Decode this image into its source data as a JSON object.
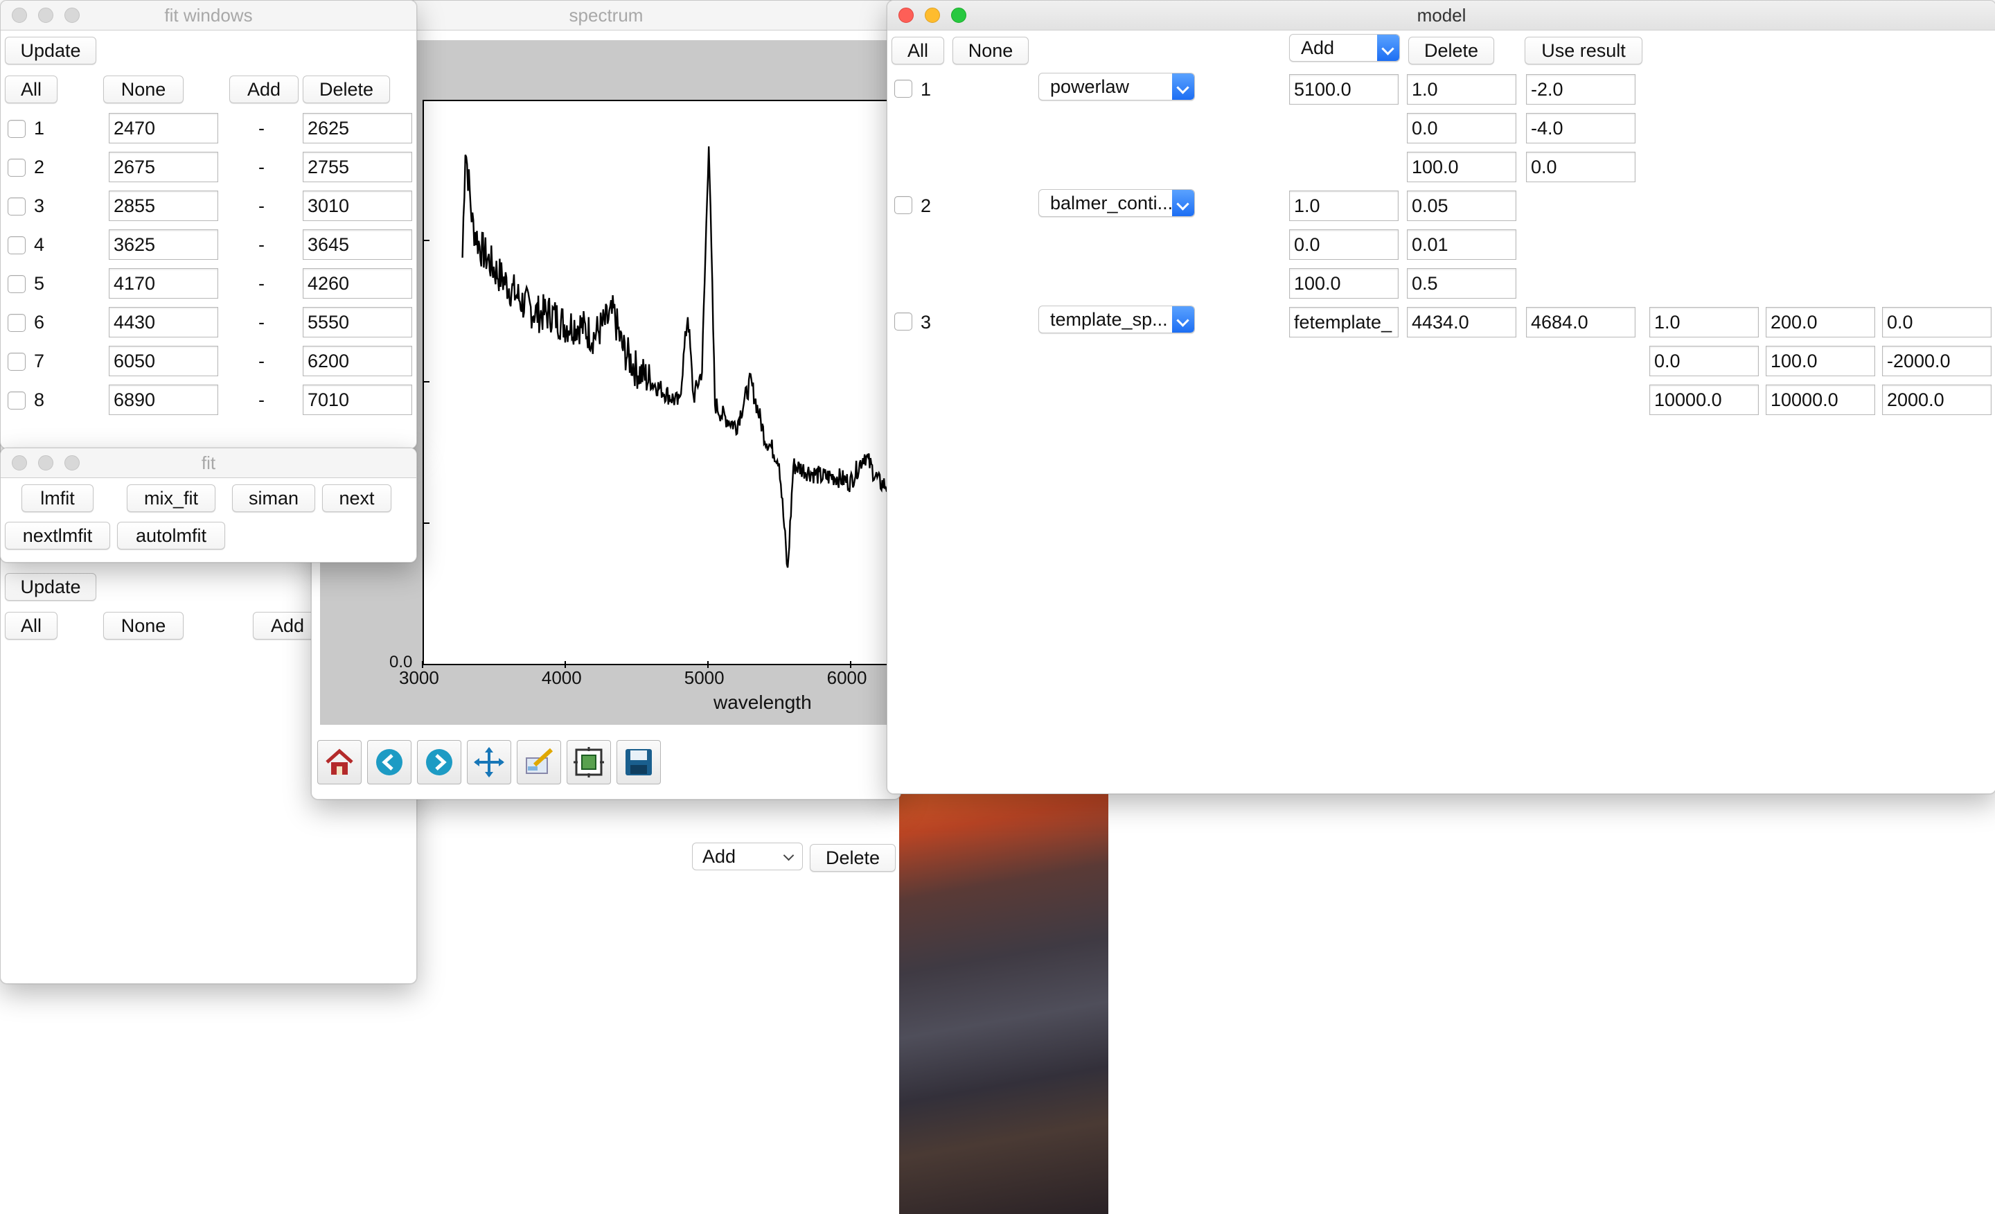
{
  "spectrum_window": {
    "title": "spectrum",
    "xaxis": {
      "label": "wavelength",
      "ticks": [
        "3000",
        "4000",
        "5000",
        "6000"
      ]
    },
    "yaxis": {
      "visible_tick": "0.0"
    },
    "toolbar": [
      "home-icon",
      "back-icon",
      "forward-icon",
      "pan-icon",
      "subplots-icon",
      "zoom-icon",
      "save-icon"
    ],
    "model_add_select": "Add",
    "model_delete_button": "Delete"
  },
  "chart_data": {
    "type": "line",
    "title": "",
    "xlabel": "wavelength",
    "ylabel": "",
    "xlim": [
      3000,
      6400
    ],
    "x_ticks": [
      3000,
      4000,
      5000,
      6000
    ],
    "y_ticks": [
      "0.0"
    ],
    "series": [
      {
        "x": [
          3280,
          3300,
          3350,
          3400,
          3500,
          3600,
          3700,
          3800,
          3900,
          4000,
          4100,
          4200,
          4340,
          4400,
          4500,
          4600,
          4700,
          4800,
          4860,
          4900,
          4960,
          5007,
          5050,
          5100,
          5200,
          5300,
          5400,
          5450,
          5500,
          5560,
          5600,
          5700,
          5800,
          5900,
          6000,
          6100,
          6200,
          6300,
          6400
        ],
        "y": [
          0.72,
          0.92,
          0.78,
          0.74,
          0.7,
          0.67,
          0.64,
          0.62,
          0.62,
          0.6,
          0.6,
          0.58,
          0.62,
          0.56,
          0.52,
          0.5,
          0.48,
          0.46,
          0.62,
          0.47,
          0.52,
          0.93,
          0.46,
          0.44,
          0.42,
          0.5,
          0.4,
          0.38,
          0.36,
          0.16,
          0.35,
          0.34,
          0.33,
          0.33,
          0.32,
          0.37,
          0.32,
          0.31,
          0.3
        ]
      }
    ]
  },
  "fit_windows": {
    "title": "fit windows",
    "update": "Update",
    "all": "All",
    "none": "None",
    "add": "Add",
    "delete": "Delete",
    "separator": "-",
    "rows": [
      {
        "id": "1",
        "low": "2470",
        "high": "2625"
      },
      {
        "id": "2",
        "low": "2675",
        "high": "2755"
      },
      {
        "id": "3",
        "low": "2855",
        "high": "3010"
      },
      {
        "id": "4",
        "low": "3625",
        "high": "3645"
      },
      {
        "id": "5",
        "low": "4170",
        "high": "4260"
      },
      {
        "id": "6",
        "low": "4430",
        "high": "5550"
      },
      {
        "id": "7",
        "low": "6050",
        "high": "6200"
      },
      {
        "id": "8",
        "low": "6890",
        "high": "7010"
      }
    ]
  },
  "fit_window": {
    "title": "fit",
    "buttons": [
      "lmfit",
      "mix_fit",
      "siman",
      "next",
      "nextlmfit",
      "autolmfit"
    ]
  },
  "back_panel": {
    "update": "Update",
    "all": "All",
    "none": "None",
    "add": "Add"
  },
  "model_window": {
    "title": "model",
    "all": "All",
    "none": "None",
    "add_select": "Add",
    "delete": "Delete",
    "use_result": "Use result",
    "components": [
      {
        "id": "1",
        "type": "powerlaw",
        "params": [
          [
            "5100.0",
            "1.0",
            "-2.0"
          ],
          [
            "",
            "0.0",
            "-4.0"
          ],
          [
            "",
            "100.0",
            "0.0"
          ]
        ]
      },
      {
        "id": "2",
        "type": "balmer_conti...",
        "params": [
          [
            "1.0",
            "0.05"
          ],
          [
            "0.0",
            "0.01"
          ],
          [
            "100.0",
            "0.5"
          ]
        ]
      },
      {
        "id": "3",
        "type": "template_sp...",
        "params_row1": [
          "fetemplate_",
          "4434.0",
          "4684.0",
          "1.0",
          "200.0",
          "0.0"
        ],
        "params_row2": [
          "0.0",
          "100.0",
          "-2000.0"
        ],
        "params_row3": [
          "10000.0",
          "10000.0",
          "2000.0"
        ]
      }
    ]
  }
}
